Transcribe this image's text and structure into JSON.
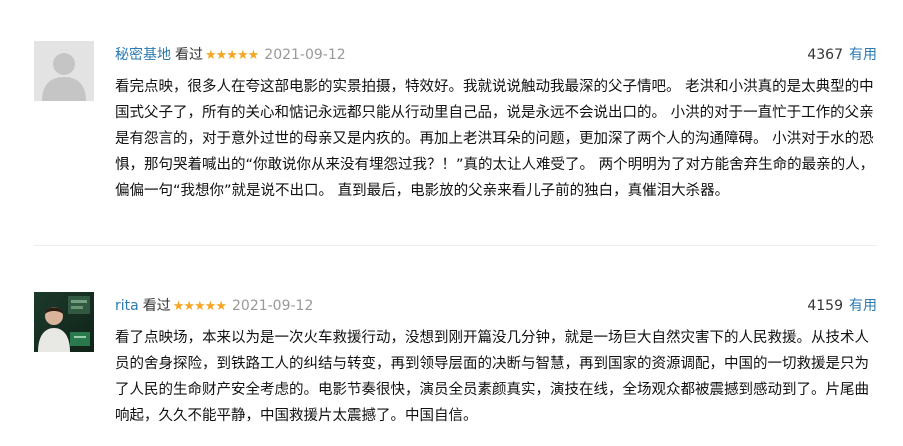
{
  "reviews": [
    {
      "user": "秘密基地",
      "status": "看过",
      "stars": "★★★★★",
      "date": "2021-09-12",
      "votes": "4367",
      "useful_label": "有用",
      "content": "看完点映，很多人在夸这部电影的实景拍摄，特效好。我就说说触动我最深的父子情吧。 老洪和小洪真的是太典型的中国式父子了，所有的关心和惦记永远都只能从行动里自己品，说是永远不会说出口的。 小洪的对于一直忙于工作的父亲是有怨言的，对于意外过世的母亲又是内疚的。再加上老洪耳朵的问题，更加深了两个人的沟通障碍。 小洪对于水的恐惧，那句哭着喊出的“你敢说你从来没有埋怨过我？！”真的太让人难受了。 两个明明为了对方能舍弃生命的最亲的人，偏偏一句“我想你”就是说不出口。 直到最后，电影放的父亲来看儿子前的独白，真催泪大杀器。"
    },
    {
      "user": "rita",
      "status": "看过",
      "stars": "★★★★★",
      "date": "2021-09-12",
      "votes": "4159",
      "useful_label": "有用",
      "content": "看了点映场，本来以为是一次火车救援行动，没想到刚开篇没几分钟，就是一场巨大自然灾害下的人民救援。从技术人员的舍身探险，到铁路工人的纠结与转变，再到领导层面的决断与智慧，再到国家的资源调配，中国的一切救援是只为了人民的生命财产安全考虑的。电影节奏很快，演员全员素颜真实，演技在线，全场观众都被震撼到感动到了。片尾曲响起，久久不能平静，中国救援片太震撼了。中国自信。"
    }
  ],
  "colors": {
    "link": "#2a7ab0",
    "star": "#f5a623",
    "date": "#999999",
    "divider": "#eeeeee"
  },
  "icons": {
    "review1_avatar": "default-user-avatar-icon",
    "review2_avatar": "user-photo-avatar"
  }
}
